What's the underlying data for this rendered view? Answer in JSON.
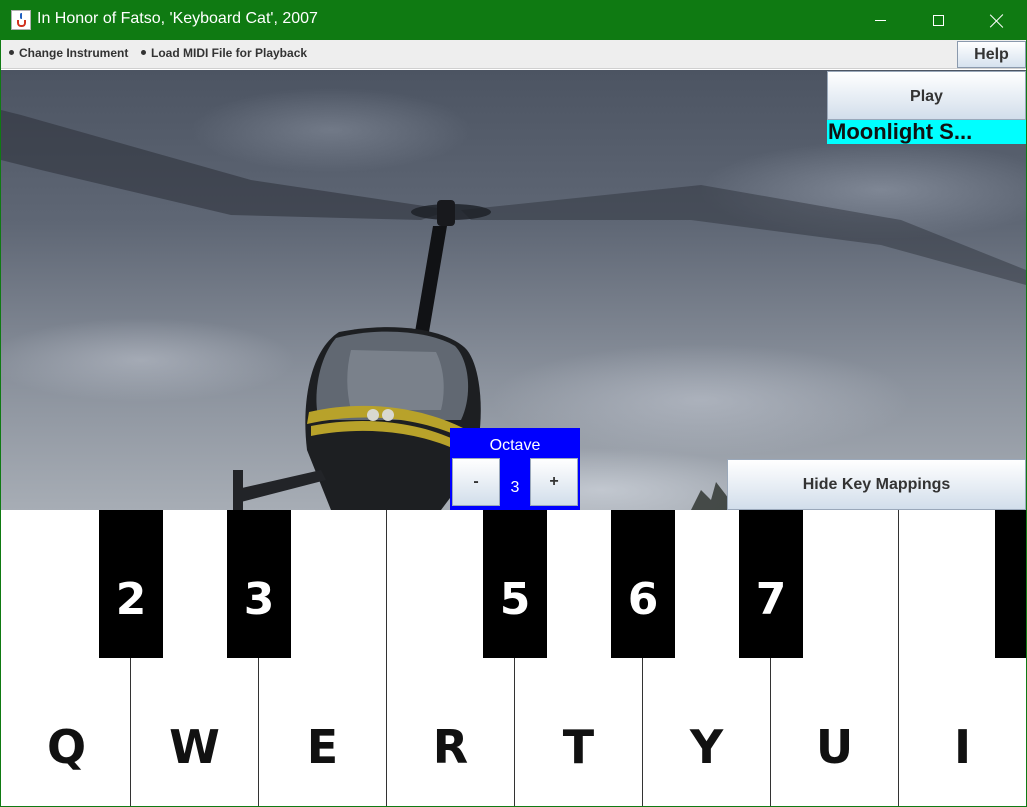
{
  "window": {
    "title": "In Honor of Fatso, 'Keyboard Cat', 2007",
    "title_bar_color": "#0f7a12"
  },
  "menu": {
    "items": [
      "Change Instrument",
      "Load MIDI File for Playback"
    ],
    "help_label": "Help"
  },
  "player": {
    "play_label": "Play",
    "song_title": "Moonlight S...",
    "song_highlight_color": "#00ffff"
  },
  "octave": {
    "label": "Octave",
    "minus_label": "-",
    "plus_label": "+",
    "value": "3",
    "panel_color": "#0000ff"
  },
  "mappings": {
    "hide_label": "Hide Key Mappings"
  },
  "keyboard": {
    "white_keys": [
      "Q",
      "W",
      "E",
      "R",
      "T",
      "Y",
      "U",
      "I"
    ],
    "black_keys": [
      "2",
      "3",
      "",
      "5",
      "6",
      "7",
      ""
    ]
  },
  "icons": {
    "app": "java-cup-icon",
    "window_controls": [
      "minimize-icon",
      "maximize-icon",
      "close-icon"
    ]
  }
}
